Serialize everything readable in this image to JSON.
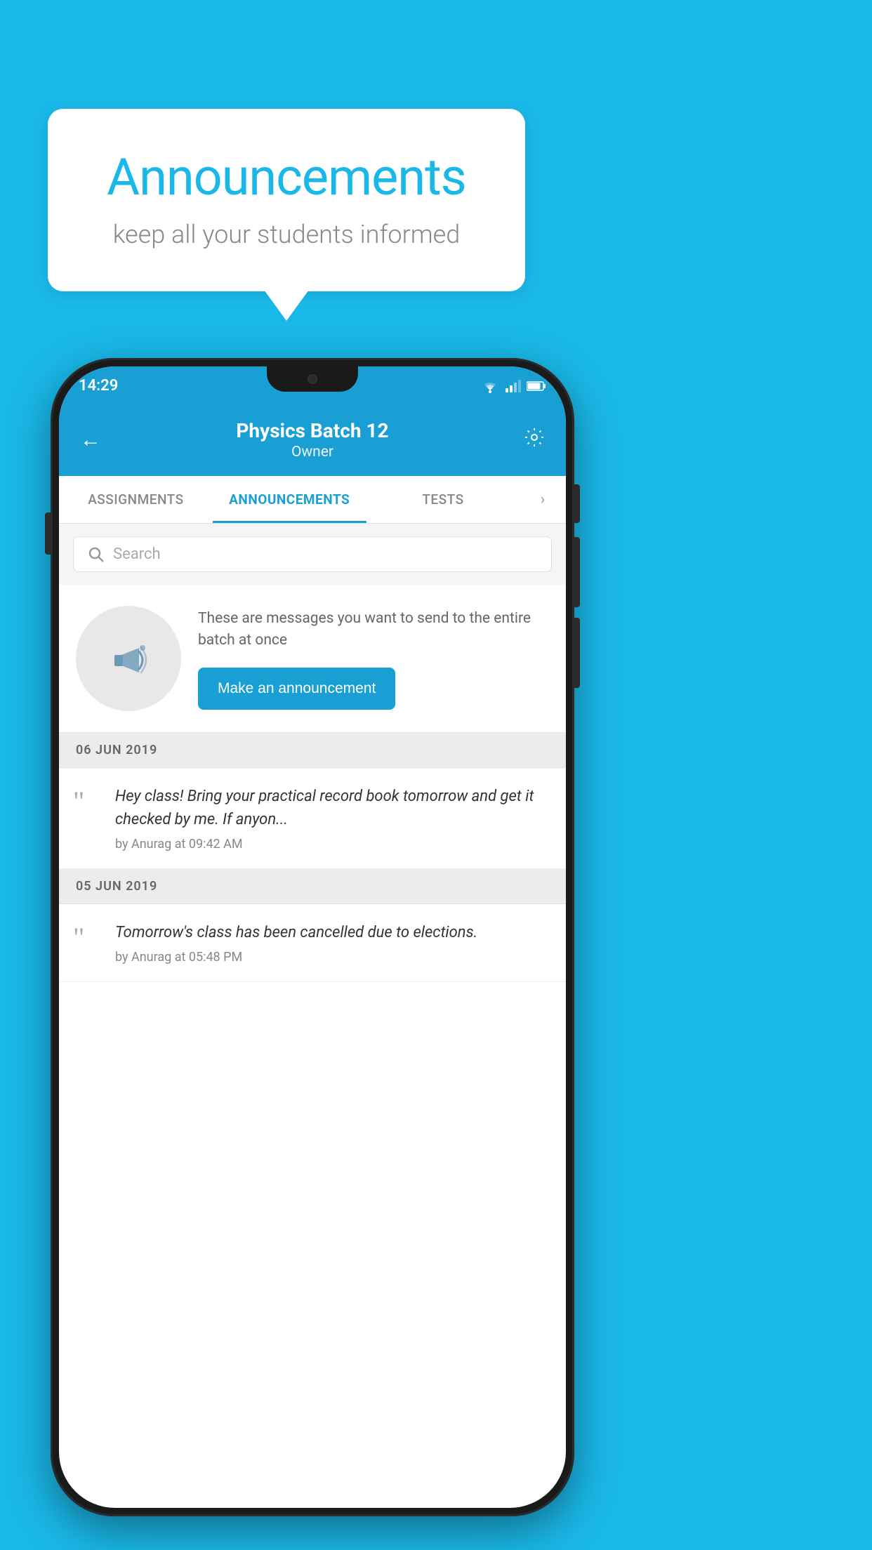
{
  "background_color": "#1ab8e8",
  "speech_bubble": {
    "title": "Announcements",
    "subtitle": "keep all your students informed"
  },
  "status_bar": {
    "time": "14:29"
  },
  "header": {
    "title": "Physics Batch 12",
    "subtitle": "Owner",
    "back_label": "←"
  },
  "tabs": [
    {
      "label": "ASSIGNMENTS",
      "active": false
    },
    {
      "label": "ANNOUNCEMENTS",
      "active": true
    },
    {
      "label": "TESTS",
      "active": false
    },
    {
      "label": "›",
      "active": false
    }
  ],
  "search": {
    "placeholder": "Search"
  },
  "empty_state": {
    "description": "These are messages you want to send to the entire batch at once",
    "button_label": "Make an announcement"
  },
  "announcements": [
    {
      "date": "06  JUN  2019",
      "text": "Hey class! Bring your practical record book tomorrow and get it checked by me. If anyon...",
      "meta": "by Anurag at 09:42 AM"
    },
    {
      "date": "05  JUN  2019",
      "text": "Tomorrow's class has been cancelled due to elections.",
      "meta": "by Anurag at 05:48 PM"
    }
  ]
}
